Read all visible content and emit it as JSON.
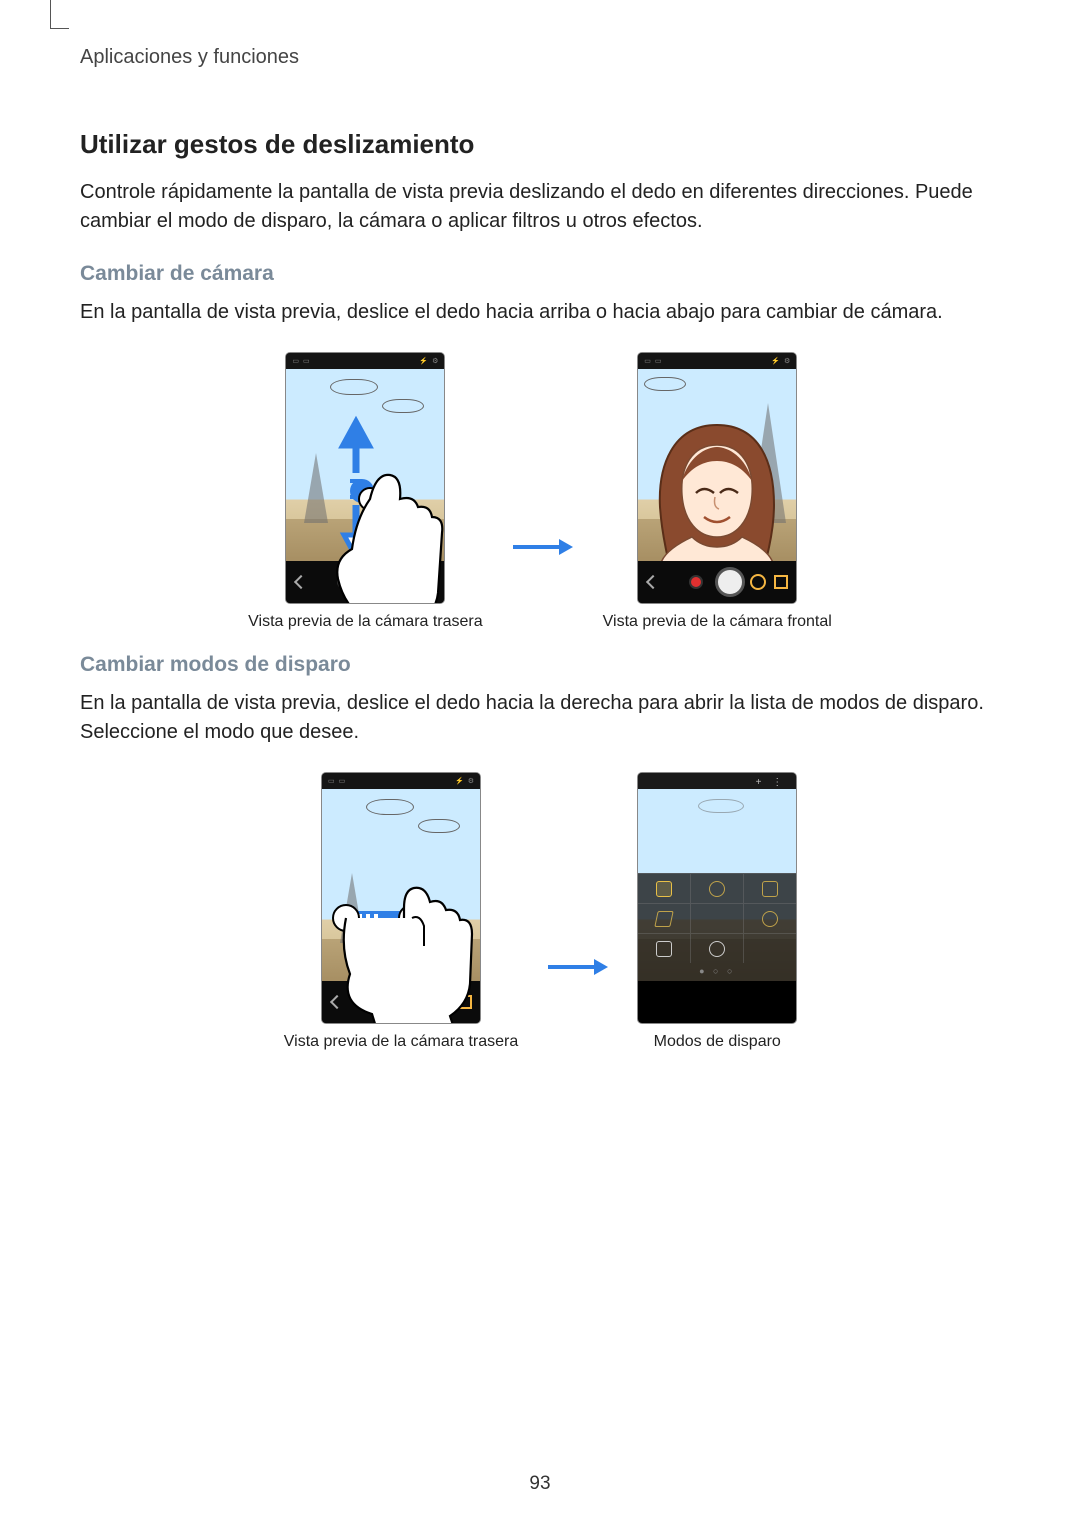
{
  "breadcrumb": "Aplicaciones y funciones",
  "section_title": "Utilizar gestos de deslizamiento",
  "intro_paragraph": "Controle rápidamente la pantalla de vista previa deslizando el dedo en diferentes direcciones. Puede cambiar el modo de disparo, la cámara o aplicar filtros u otros efectos.",
  "sub1_title": "Cambiar de cámara",
  "sub1_paragraph": "En la pantalla de vista previa, deslice el dedo hacia arriba o hacia abajo para cambiar de cámara.",
  "fig1_left_caption": "Vista previa de la cámara trasera",
  "fig1_right_caption": "Vista previa de la cámara frontal",
  "sub2_title": "Cambiar modos de disparo",
  "sub2_paragraph": "En la pantalla de vista previa, deslice el dedo hacia la derecha para abrir la lista de modos de disparo. Seleccione el modo que desee.",
  "fig2_left_caption": "Vista previa de la cámara trasera",
  "fig2_right_caption": "Modos de disparo",
  "page_number": "93"
}
